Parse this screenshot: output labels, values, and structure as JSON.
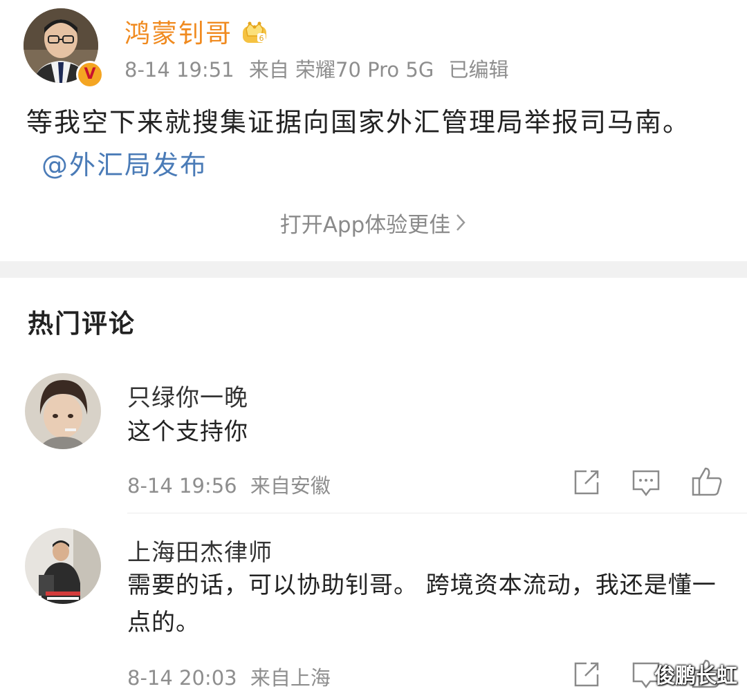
{
  "post": {
    "author": "鸿蒙钊哥",
    "crown_badge_level": "6",
    "time": "8-14 19:51",
    "source": "来自 荣耀70 Pro 5G",
    "edited": "已编辑",
    "body_text": "等我空下来就搜集证据向国家外汇管理局举报司马南。",
    "mention": "@外汇局发布",
    "open_app": "打开App体验更佳",
    "verified_mark": "V"
  },
  "comments_section": {
    "title": "热门评论",
    "comments": [
      {
        "name": "只绿你一晚",
        "text": "这个支持你",
        "time": "8-14 19:56",
        "source": "来自安徽"
      },
      {
        "name": "上海田杰律师",
        "text": "需要的话，可以协助钊哥。 跨境资本流动，我还是懂一点的。",
        "time": "8-14 20:03",
        "source": "来自上海"
      }
    ]
  },
  "watermark": "俊鹏长虹",
  "colors": {
    "author_name": "#f08a1f",
    "mention_link": "#4a7bb7",
    "meta_gray": "#8e8e8e",
    "section_band": "#f1f1f1"
  },
  "icons": [
    "crown-icon",
    "verified-badge-icon",
    "chevron-right-icon",
    "share-icon",
    "comment-icon",
    "like-icon"
  ]
}
